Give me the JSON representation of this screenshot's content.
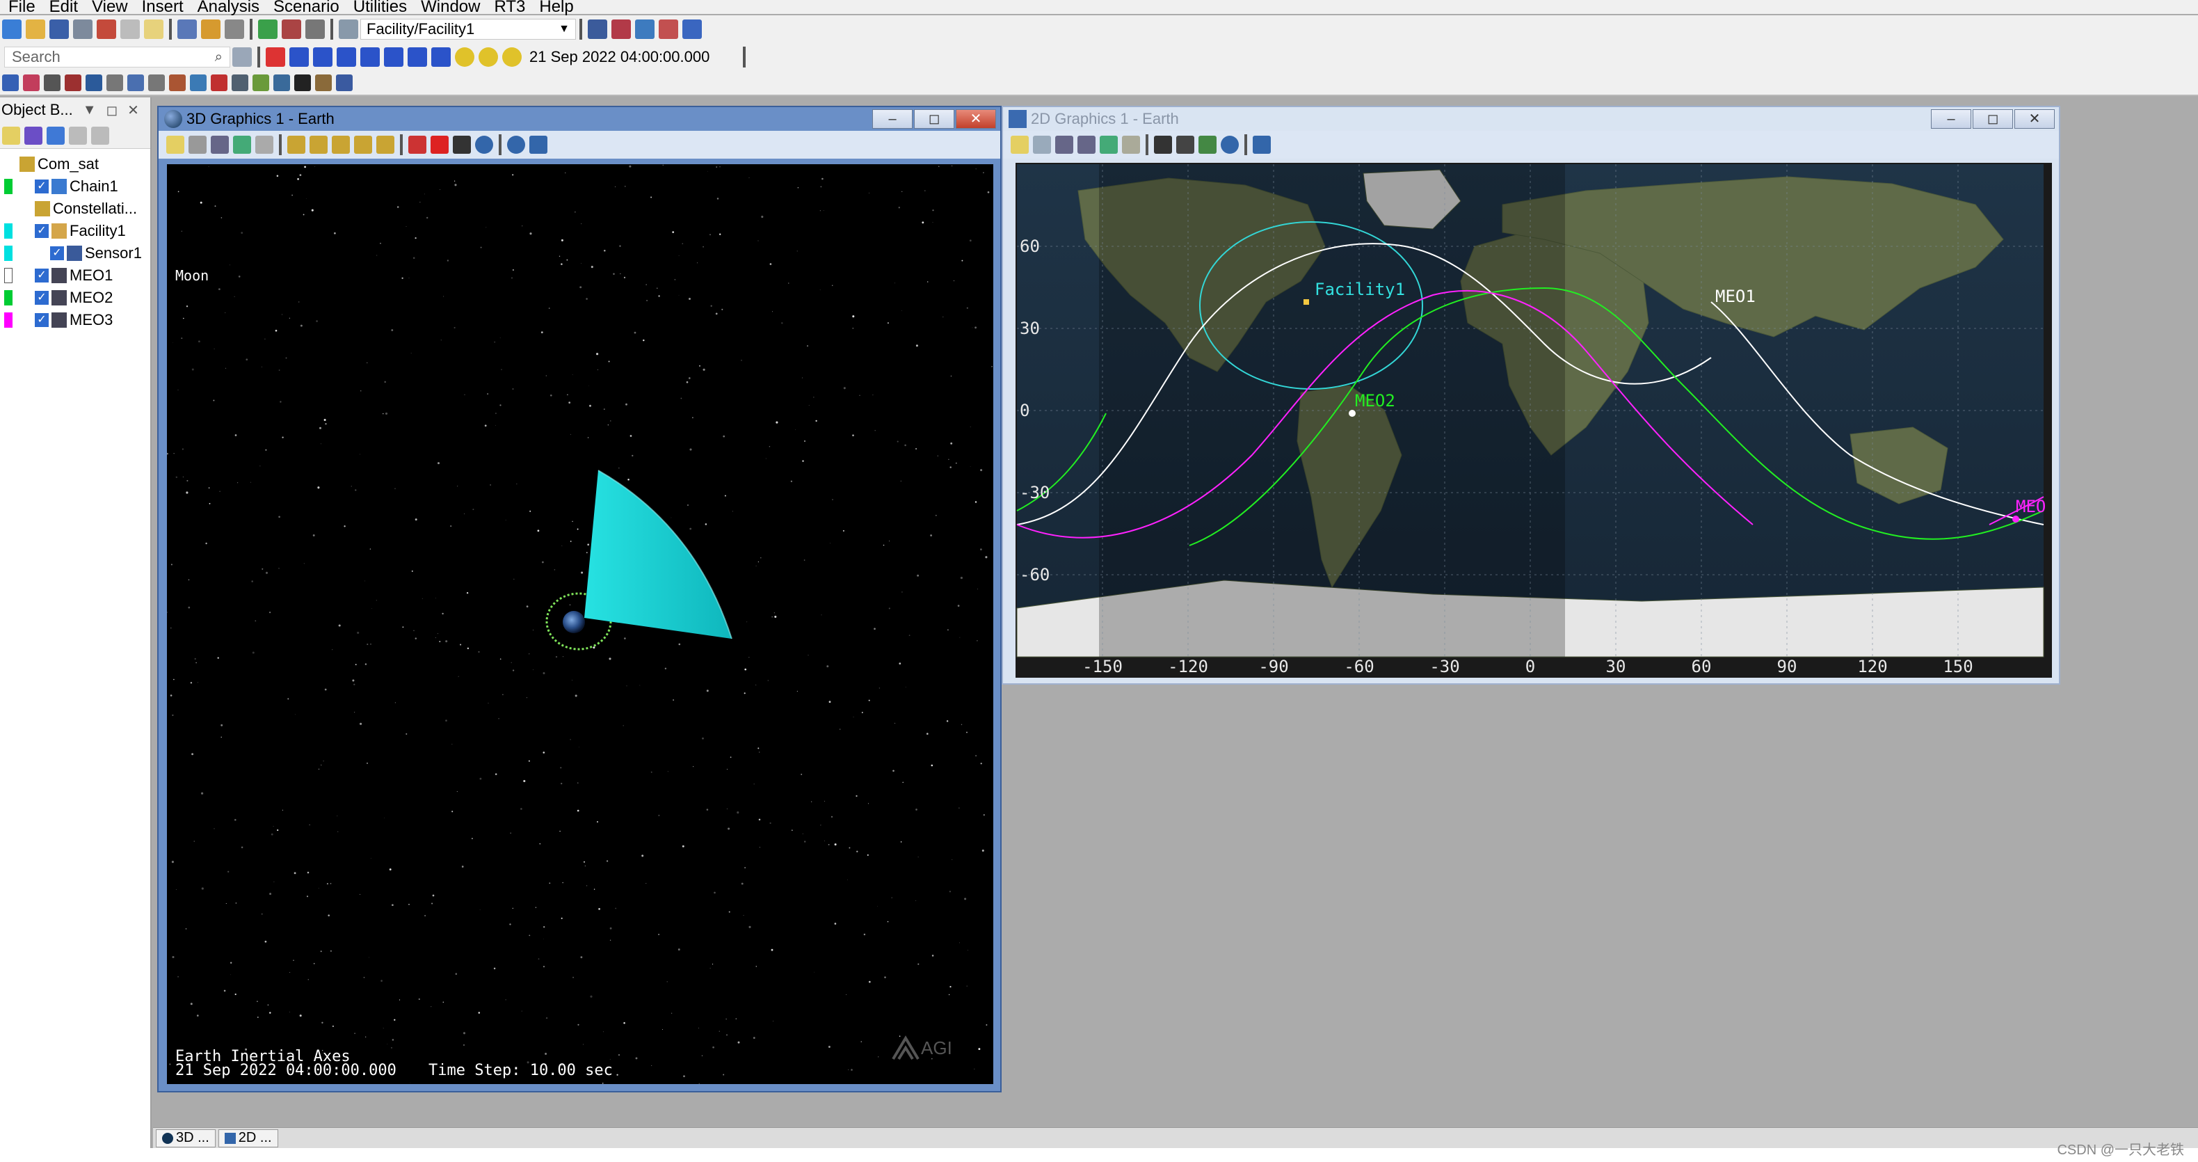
{
  "menu": [
    "File",
    "Edit",
    "View",
    "Insert",
    "Analysis",
    "Scenario",
    "Utilities",
    "Window",
    "RT3",
    "Help"
  ],
  "toolbar": {
    "object_combo": "Facility/Facility1",
    "time_combo": "21 Sep 2022 04:00:00.000",
    "search_placeholder": "Search"
  },
  "object_browser": {
    "title": "Object B...",
    "tree": [
      {
        "label": "Com_sat",
        "level": 0,
        "color": "",
        "icon": "scenario-icon",
        "checked": false
      },
      {
        "label": "Chain1",
        "level": 1,
        "color": "#00cc33",
        "icon": "chain-icon",
        "checked": true
      },
      {
        "label": "Constellati...",
        "level": 1,
        "color": "",
        "icon": "constellation-icon",
        "checked": false
      },
      {
        "label": "Facility1",
        "level": 1,
        "color": "#00e0e0",
        "icon": "facility-icon",
        "checked": true
      },
      {
        "label": "Sensor1",
        "level": 2,
        "color": "#00e0e0",
        "icon": "sensor-icon",
        "checked": true
      },
      {
        "label": "MEO1",
        "level": 1,
        "color": "#ffffff",
        "icon": "satellite-icon",
        "checked": true
      },
      {
        "label": "MEO2",
        "level": 1,
        "color": "#00cc33",
        "icon": "satellite-icon",
        "checked": true
      },
      {
        "label": "MEO3",
        "level": 1,
        "color": "#ff00ff",
        "icon": "satellite-icon",
        "checked": true
      }
    ]
  },
  "window3d": {
    "title": "3D Graphics 1 - Earth",
    "label_moon": "Moon",
    "footer_axes": "Earth Inertial Axes",
    "footer_time": "21 Sep 2022 04:00:00.000",
    "footer_step": "Time Step: 10.00 sec",
    "logo": "AGI",
    "sensor_color": "#19d6d6",
    "orbit_color": "#7fe35a"
  },
  "window2d": {
    "title": "2D Graphics 1 - Earth",
    "lat_labels": [
      "60",
      "30",
      "0",
      "-30",
      "-60"
    ],
    "lon_labels": [
      "-150",
      "-120",
      "-90",
      "-60",
      "-30",
      "0",
      "30",
      "60",
      "90",
      "120",
      "150"
    ],
    "labels": {
      "facility": "Facility1",
      "meo1": "MEO1",
      "meo2": "MEO2",
      "meo3": "MEO"
    },
    "colors": {
      "meo1": "#ffffff",
      "meo2": "#22ee22",
      "meo3": "#ff22ff",
      "facility": "#33e0e0"
    }
  },
  "taskbar": [
    "3D ...",
    "2D ..."
  ],
  "watermark": "CSDN @一只大老铁"
}
